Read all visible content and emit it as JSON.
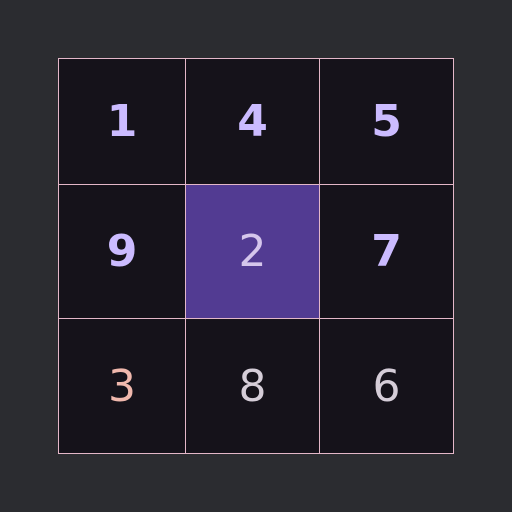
{
  "board": {
    "cells": [
      {
        "value": "1",
        "state": "given"
      },
      {
        "value": "4",
        "state": "given"
      },
      {
        "value": "5",
        "state": "given"
      },
      {
        "value": "9",
        "state": "given"
      },
      {
        "value": "2",
        "state": "selected"
      },
      {
        "value": "7",
        "state": "given"
      },
      {
        "value": "3",
        "state": "conflict"
      },
      {
        "value": "8",
        "state": "entry"
      },
      {
        "value": "6",
        "state": "entry"
      }
    ]
  },
  "colors": {
    "background": "#2b2c30",
    "grid_line": "#e3b7c8",
    "cell_background": "#15121a",
    "selected_cell": "#523b92",
    "given_digit": "#cbbbff",
    "entry_digit": "#d5cdd8",
    "conflict_digit": "#f0b8ad"
  }
}
